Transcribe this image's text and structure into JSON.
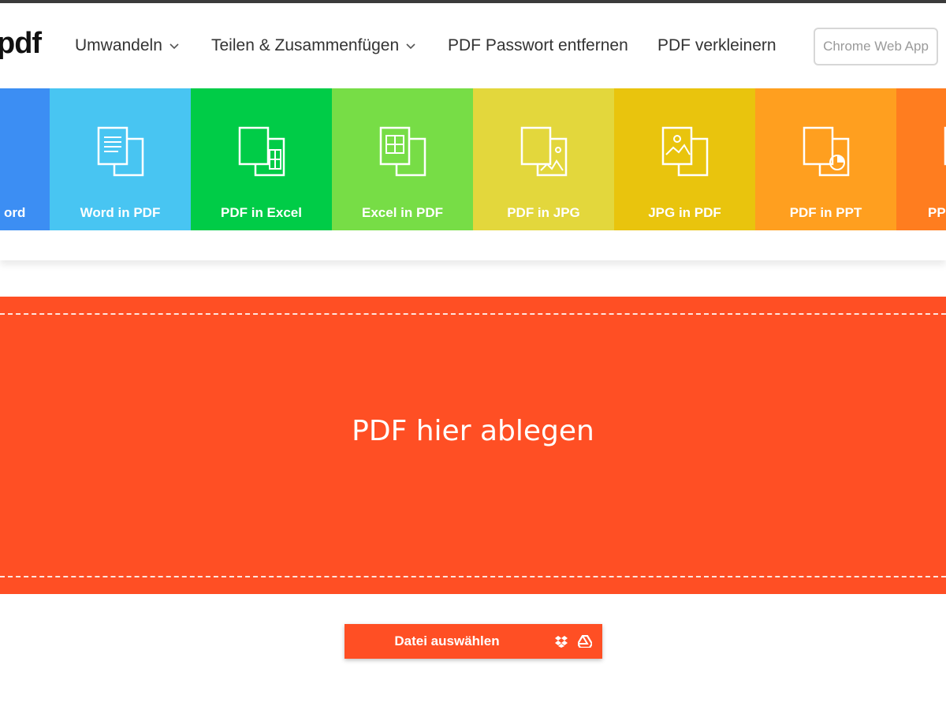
{
  "header": {
    "logo_text": "pdf",
    "nav": [
      {
        "label": "Umwandeln",
        "has_dropdown": true
      },
      {
        "label": "Teilen & Zusammenfügen",
        "has_dropdown": true
      },
      {
        "label": "PDF Passwort entfernen",
        "has_dropdown": false
      },
      {
        "label": "PDF verkleinern",
        "has_dropdown": false
      }
    ],
    "chrome_button": "Chrome Web App"
  },
  "tools": [
    {
      "label": "ord",
      "color": "#3c8ef3",
      "icon": "document-icon"
    },
    {
      "label": "Word in PDF",
      "color": "#48c5f2",
      "icon": "word-document-icon"
    },
    {
      "label": "PDF in Excel",
      "color": "#00cc47",
      "icon": "excel-document-icon"
    },
    {
      "label": "Excel in PDF",
      "color": "#77dd46",
      "icon": "spreadsheet-icon"
    },
    {
      "label": "PDF in JPG",
      "color": "#e3d73c",
      "icon": "image-document-icon"
    },
    {
      "label": "JPG in PDF",
      "color": "#e9c40d",
      "icon": "picture-icon"
    },
    {
      "label": "PDF in PPT",
      "color": "#ff9f1f",
      "icon": "presentation-icon"
    },
    {
      "label": "PP",
      "color": "#ff7d1f",
      "icon": "presentation-icon"
    }
  ],
  "dropzone": {
    "text": "PDF hier ablegen",
    "color": "#ff4f24"
  },
  "choose_file": {
    "label": "Datei auswählen",
    "icons": [
      "dropbox-icon",
      "google-drive-icon"
    ]
  }
}
